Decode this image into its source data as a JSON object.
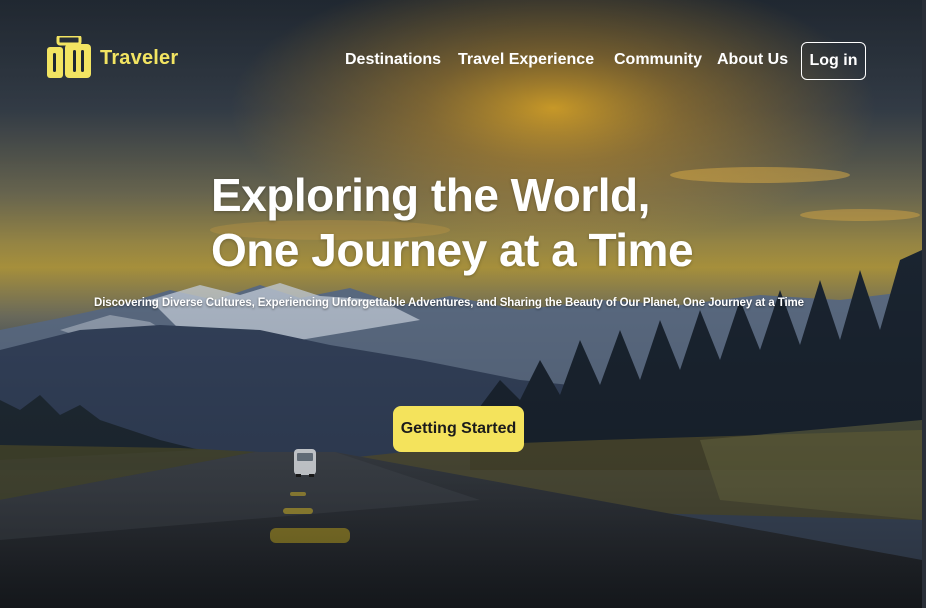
{
  "brand": {
    "name": "Traveler",
    "icon": "luggage-icon",
    "color": "#f2e462"
  },
  "nav": {
    "items": [
      {
        "label": "Destinations"
      },
      {
        "label": "Travel Experience"
      },
      {
        "label": "Community"
      },
      {
        "label": "About Us"
      }
    ],
    "login_label": "Log in"
  },
  "hero": {
    "headline_line1": "Exploring the World,",
    "headline_line2": "One Journey at a Time",
    "subheadline": "Discovering Diverse Cultures, Experiencing Unforgettable Adventures, and Sharing the Beauty of Our Planet, One Journey at a Time",
    "cta_label": "Getting Started",
    "cta_color": "#f4e35c"
  }
}
